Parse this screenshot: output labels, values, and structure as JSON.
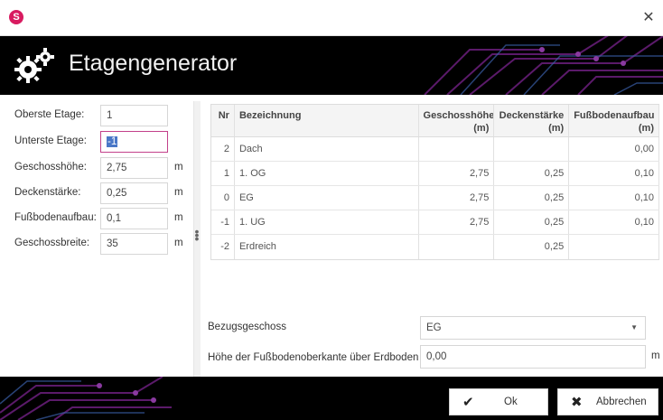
{
  "window": {
    "app_icon_letter": "S",
    "close_glyph": "✕"
  },
  "header": {
    "title": "Etagengenerator",
    "icon": "gears-icon"
  },
  "form": {
    "rows": [
      {
        "label": "Oberste Etage:",
        "value": "1",
        "unit": ""
      },
      {
        "label": "Unterste Etage:",
        "value": "-1",
        "unit": ""
      },
      {
        "label": "Geschosshöhe:",
        "value": "2,75",
        "unit": "m"
      },
      {
        "label": "Deckenstärke:",
        "value": "0,25",
        "unit": "m"
      },
      {
        "label": "Fußbodenaufbau:",
        "value": "0,1",
        "unit": "m"
      },
      {
        "label": "Geschossbreite:",
        "value": "35",
        "unit": "m"
      }
    ]
  },
  "table": {
    "headers": {
      "nr": "Nr",
      "bezeichnung": "Bezeichnung",
      "geschosshoehe": "Geschosshöhe (m)",
      "deckenstaerke": "Deckenstärke (m)",
      "fussbodenaufbau": "Fußbodenaufbau (m)"
    },
    "rows": [
      {
        "nr": "2",
        "bezeichnung": "Dach",
        "geschosshoehe": "",
        "deckenstaerke": "",
        "fussbodenaufbau": "0,00"
      },
      {
        "nr": "1",
        "bezeichnung": "1. OG",
        "geschosshoehe": "2,75",
        "deckenstaerke": "0,25",
        "fussbodenaufbau": "0,10"
      },
      {
        "nr": "0",
        "bezeichnung": "EG",
        "geschosshoehe": "2,75",
        "deckenstaerke": "0,25",
        "fussbodenaufbau": "0,10"
      },
      {
        "nr": "-1",
        "bezeichnung": "1. UG",
        "geschosshoehe": "2,75",
        "deckenstaerke": "0,25",
        "fussbodenaufbau": "0,10"
      },
      {
        "nr": "-2",
        "bezeichnung": "Erdreich",
        "geschosshoehe": "",
        "deckenstaerke": "0,25",
        "fussbodenaufbau": ""
      }
    ]
  },
  "bezugsgeschoss": {
    "label": "Bezugsgeschoss",
    "value": "EG"
  },
  "hoehe": {
    "label": "Höhe der Fußbodenoberkante über Erdboden",
    "value": "0,00",
    "unit": "m"
  },
  "buttons": {
    "ok": "Ok",
    "cancel": "Abbrechen"
  },
  "colors": {
    "brand": "#d81b60",
    "banner": "#000000",
    "circuit": "#7a2a8a",
    "selection": "#4a78c7"
  }
}
